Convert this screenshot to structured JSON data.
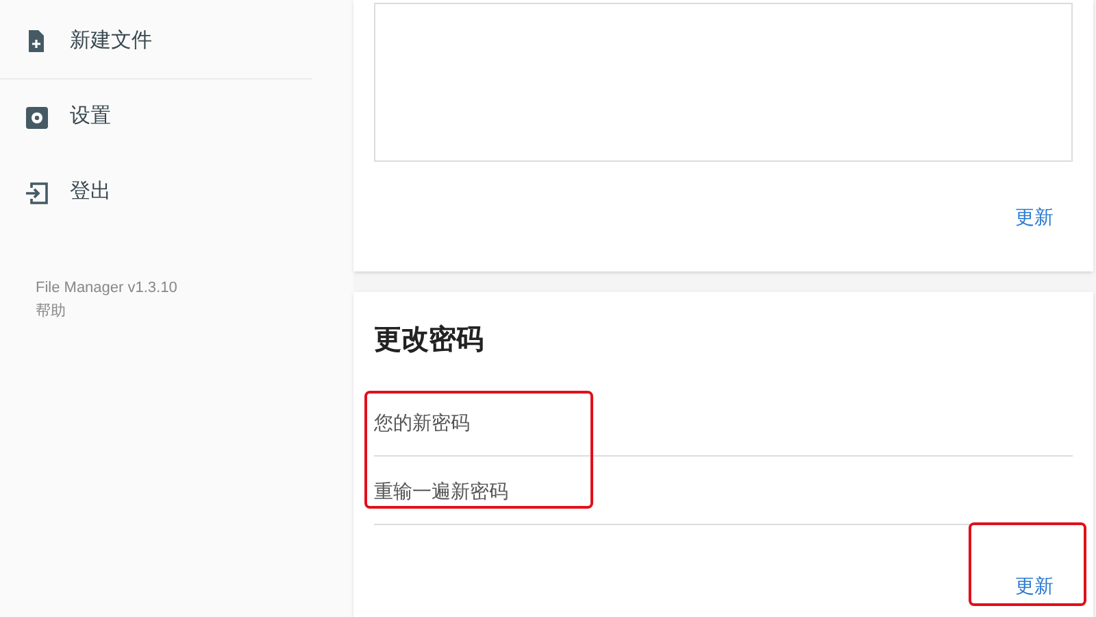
{
  "sidebar": {
    "items": [
      {
        "kind": "new-file",
        "label": "新建文件"
      },
      {
        "kind": "settings",
        "label": "设置"
      },
      {
        "kind": "logout",
        "label": "登出"
      }
    ],
    "version": "File Manager v1.3.10",
    "help": "帮助"
  },
  "top_card": {
    "button": "更新"
  },
  "password_card": {
    "title": "更改密码",
    "fields": [
      {
        "placeholder": "您的新密码"
      },
      {
        "placeholder": "重输一遍新密码"
      }
    ],
    "fields_highlighted": true,
    "button": "更新",
    "button_highlighted": true
  }
}
